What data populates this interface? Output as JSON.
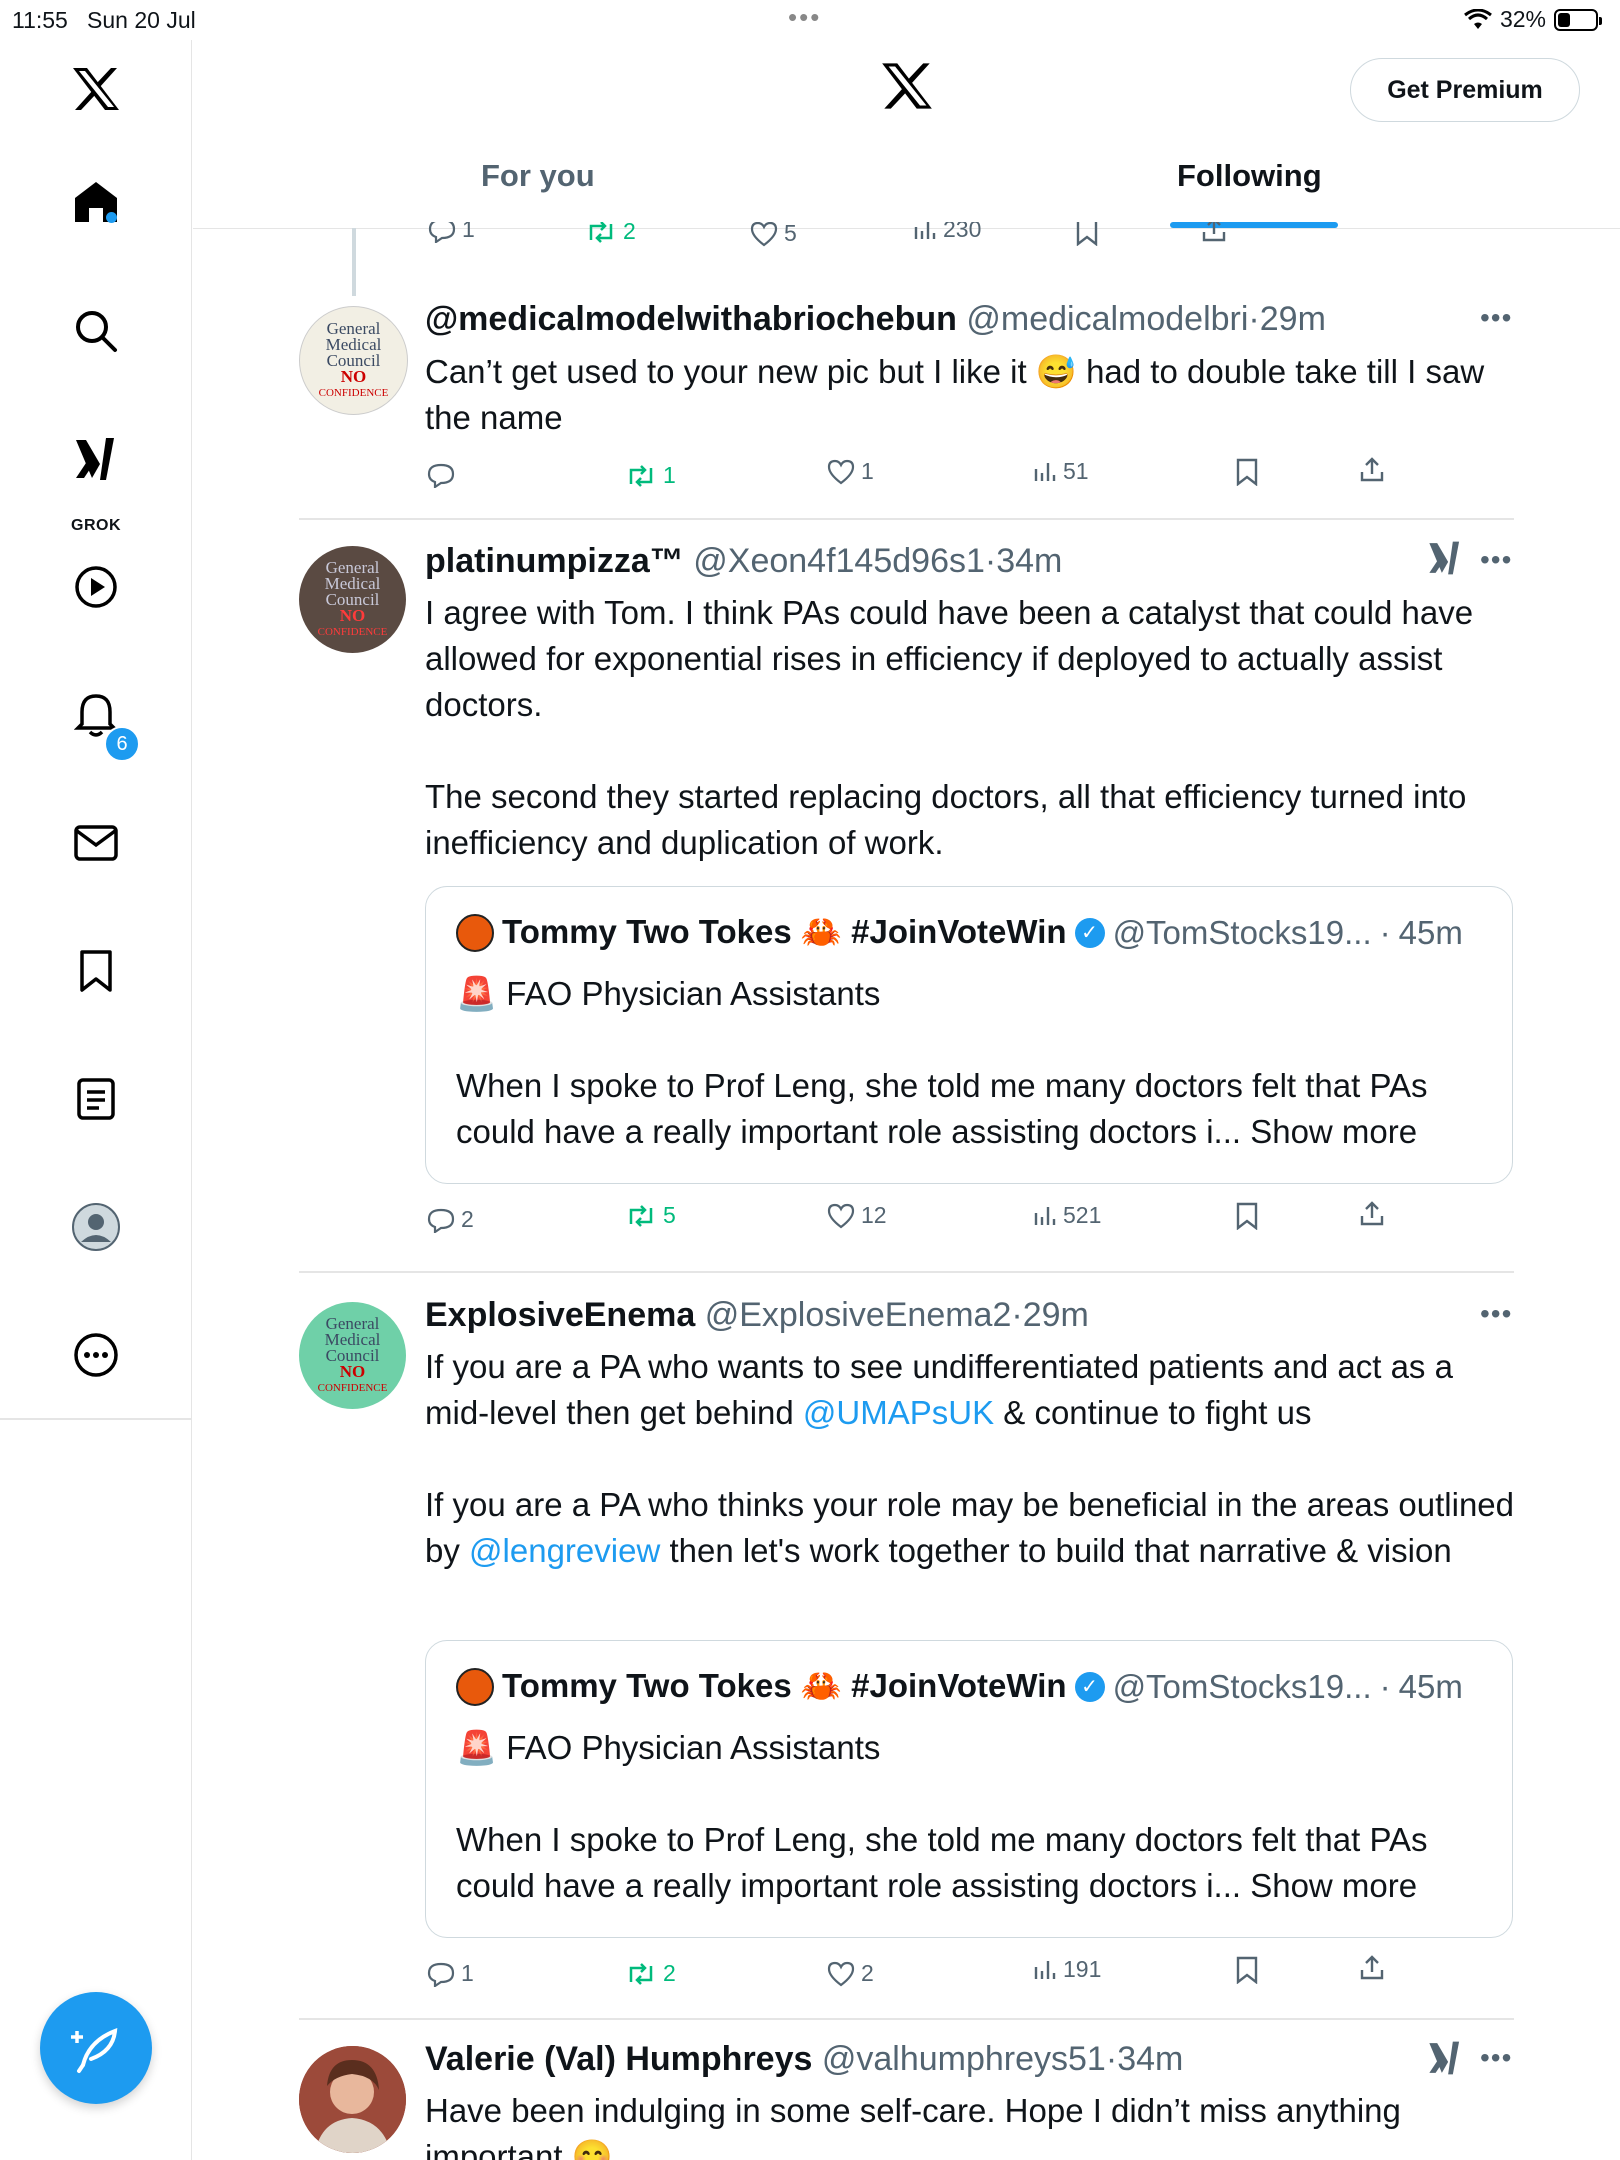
{
  "status_bar": {
    "time": "11:55",
    "date": "Sun 20 Jul",
    "battery": "32%"
  },
  "header": {
    "premium_label": "Get Premium",
    "tabs": [
      {
        "label": "For you"
      },
      {
        "label": "Following"
      }
    ]
  },
  "sidebar": {
    "grok_label": "GROK",
    "notifications_count": "6",
    "icons": [
      "x-logo-icon",
      "home-icon",
      "search-icon",
      "grok-icon",
      "video-icon",
      "bell-icon",
      "mail-icon",
      "bookmark-icon",
      "lists-icon",
      "profile-icon",
      "more-icon"
    ]
  },
  "prev_actions": {
    "replies": "1",
    "reposts": "2",
    "likes": "5",
    "views": "230"
  },
  "posts": [
    {
      "name": "@medicalmodelwithabriochebun",
      "handle": "@medicalmodelbri",
      "time": "29m",
      "avatar_text": [
        "General",
        "Medical",
        "Council",
        "NO",
        "CONFIDENCE"
      ],
      "body": [
        "Can’t get used to your new pic but I like it 😅 had to double take till I saw the name"
      ],
      "actions": {
        "replies": "",
        "reposts": "1",
        "likes": "1",
        "views": "51"
      }
    },
    {
      "name": "platinumpizza™",
      "handle": "@Xeon4f145d96s1",
      "time": "34m",
      "avatar_text": [
        "General",
        "Medical",
        "Council",
        "NO",
        "CONFIDENCE"
      ],
      "body": [
        "I agree with Tom. I think PAs could have been a catalyst that could have allowed for exponential rises in efficiency if deployed to actually assist doctors.",
        "The second they started replacing doctors, all that efficiency turned into inefficiency and duplication of work."
      ],
      "quote": {
        "name": "Tommy Two Tokes 🦀 #JoinVoteWin",
        "handle": "@TomStocks19...",
        "time": "45m",
        "line1": "🚨 FAO Physician Assistants",
        "line2": "When I spoke to Prof Leng, she told me many doctors felt that PAs could have a really important role assisting doctors i... Show more"
      },
      "actions": {
        "replies": "2",
        "reposts": "5",
        "likes": "12",
        "views": "521"
      }
    },
    {
      "name": "ExplosiveEnema",
      "handle": "@ExplosiveEnema2",
      "time": "29m",
      "avatar_text": [
        "General",
        "Medical",
        "Council",
        "NO",
        "CONFIDENCE"
      ],
      "body_parts": {
        "p1_a": "If you are a PA who wants to see undifferentiated patients and act as a mid-level then get behind ",
        "p1_link": "@UMAPsUK",
        "p1_b": " & continue to fight us",
        "p2_a": "If you are a PA who thinks your role may be beneficial in the areas outlined by ",
        "p2_link": "@lengreview",
        "p2_b": " then let's work together to build that narrative & vision"
      },
      "quote": {
        "name": "Tommy Two Tokes 🦀 #JoinVoteWin",
        "handle": "@TomStocks19...",
        "time": "45m",
        "line1": "🚨 FAO Physician Assistants",
        "line2": "When I spoke to Prof Leng, she told me many doctors felt that PAs could have a really important role assisting doctors i... Show more"
      },
      "actions": {
        "replies": "1",
        "reposts": "2",
        "likes": "2",
        "views": "191"
      }
    },
    {
      "name": "Valerie (Val) Humphreys",
      "handle": "@valhumphreys51",
      "time": "34m",
      "body": [
        "Have been indulging in some self-care. Hope I didn’t miss anything important 😊"
      ]
    }
  ],
  "colors": {
    "accent": "#1d9bf0",
    "repost": "#00ba7c",
    "muted": "#536471"
  }
}
